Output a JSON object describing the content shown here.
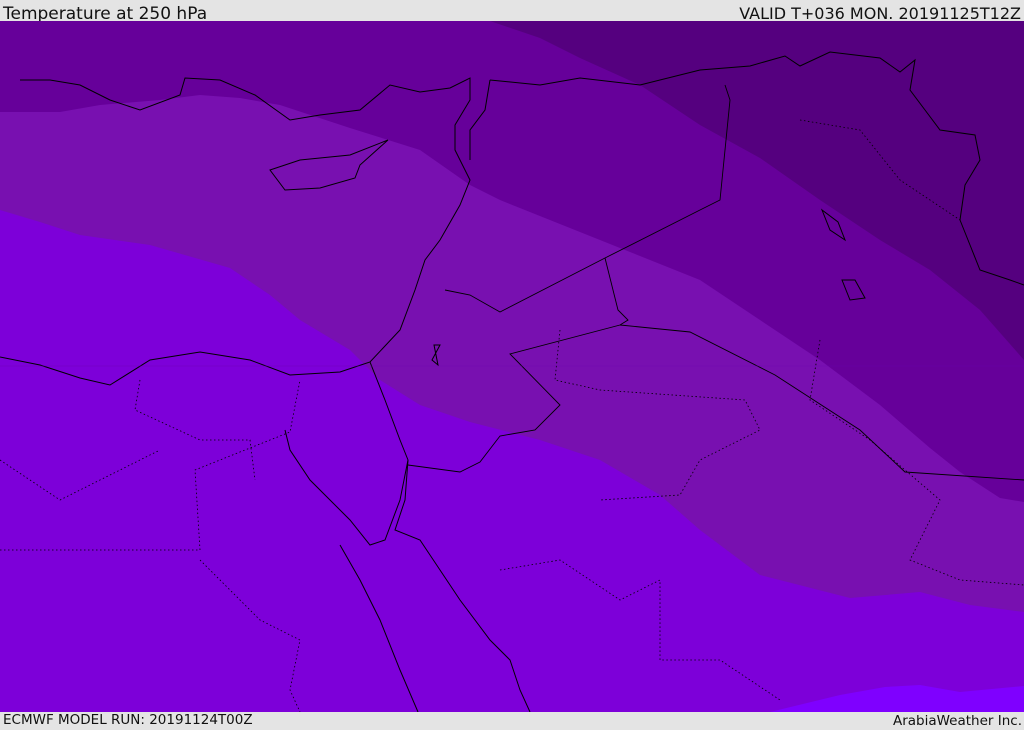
{
  "header": {
    "title": "Temperature at 250 hPa",
    "valid": "VALID T+036 MON. 20191125T12Z"
  },
  "footer": {
    "model_run": "ECMWF MODEL RUN: 20191124T00Z",
    "credit": "ArabiaWeather Inc."
  },
  "map": {
    "variable": "Temperature",
    "level": "250 hPa",
    "band_colors": [
      "#7f00ff",
      "#7d00d9",
      "#7810b0",
      "#66009a",
      "#55007f"
    ]
  }
}
